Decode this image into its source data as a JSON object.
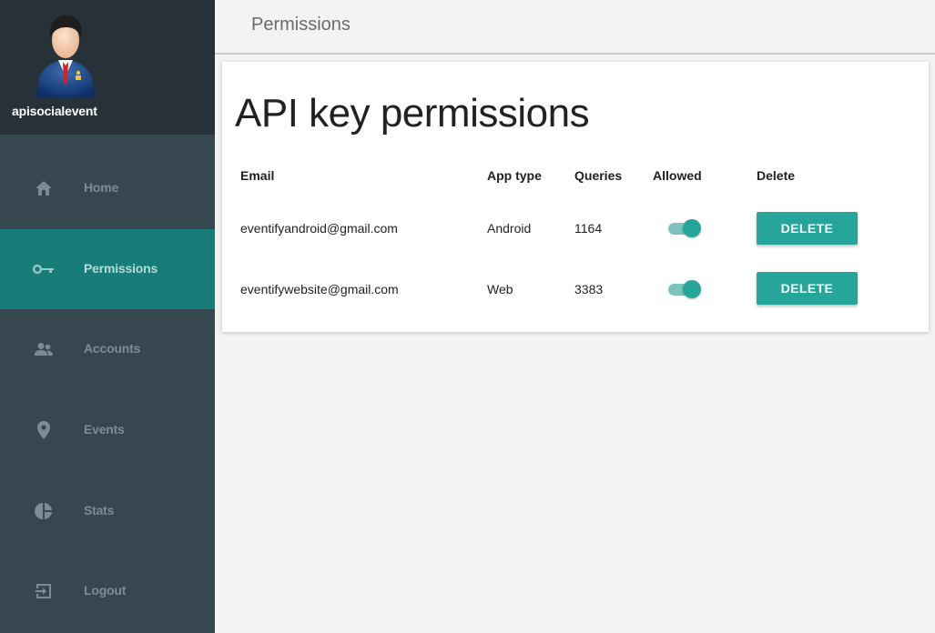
{
  "user": {
    "name": "apisocialevent",
    "avatar_icon": "businessman-avatar-icon"
  },
  "sidebar": {
    "items": [
      {
        "label": "Home",
        "icon": "home-icon",
        "active": false
      },
      {
        "label": "Permissions",
        "icon": "key-icon",
        "active": true
      },
      {
        "label": "Accounts",
        "icon": "people-icon",
        "active": false
      },
      {
        "label": "Events",
        "icon": "location-pin-icon",
        "active": false
      },
      {
        "label": "Stats",
        "icon": "pie-chart-icon",
        "active": false
      },
      {
        "label": "Logout",
        "icon": "logout-icon",
        "active": false
      }
    ]
  },
  "header": {
    "title": "Permissions"
  },
  "main": {
    "title": "API key permissions",
    "table": {
      "columns": [
        "Email",
        "App type",
        "Queries",
        "Allowed",
        "Delete"
      ],
      "rows": [
        {
          "email": "eventifyandroid@gmail.com",
          "app_type": "Android",
          "queries": "1164",
          "allowed": true,
          "delete_label": "DELETE"
        },
        {
          "email": "eventifywebsite@gmail.com",
          "app_type": "Web",
          "queries": "3383",
          "allowed": true,
          "delete_label": "DELETE"
        }
      ]
    }
  },
  "colors": {
    "sidebar_bg": "#37474f",
    "profile_bg": "#263238",
    "active_item_bg": "#167d79",
    "accent": "#26a69a",
    "page_bg": "#f3f3f3"
  }
}
